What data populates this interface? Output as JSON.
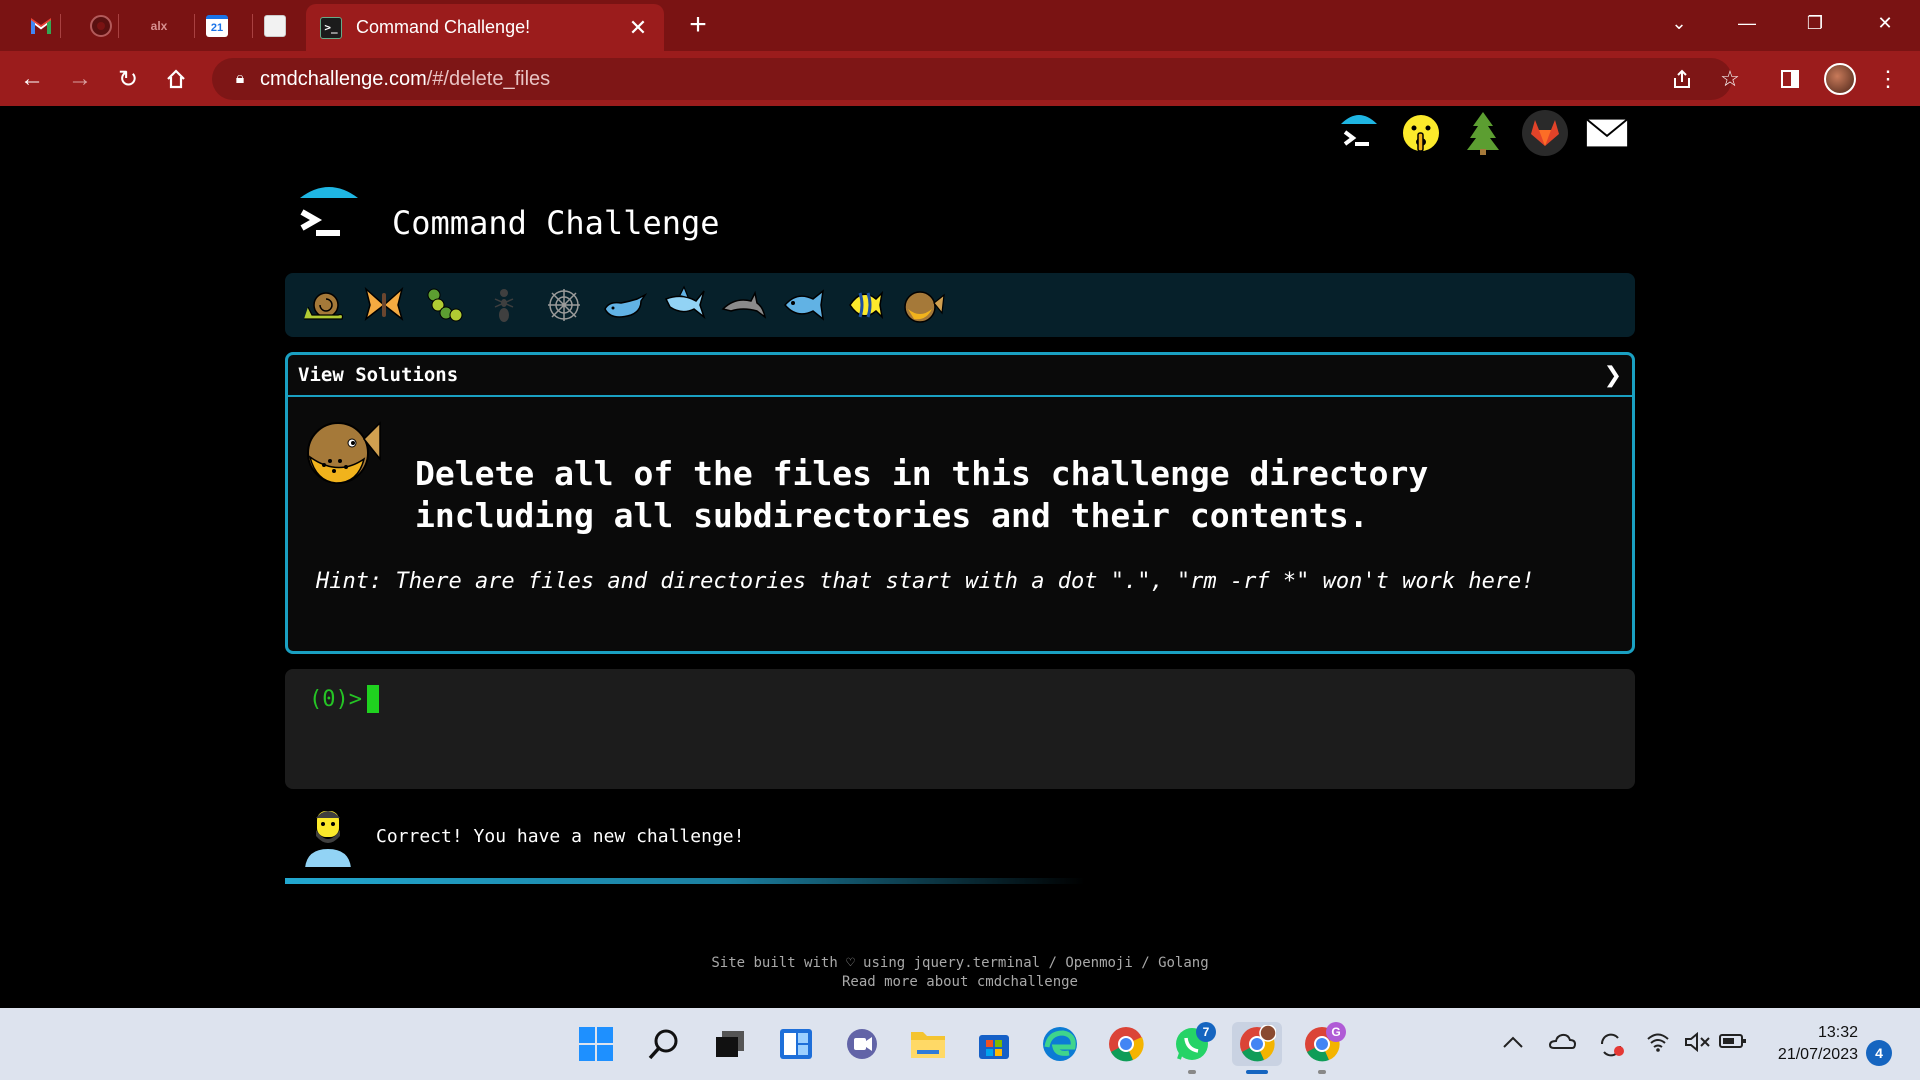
{
  "browser": {
    "pinned_tabs": [
      {
        "icon": "gmail-icon",
        "glyph": "M",
        "color": "#ea4335"
      },
      {
        "icon": "github-icon",
        "glyph": "",
        "color": "#444"
      },
      {
        "icon": "alx-icon",
        "glyph": "alx",
        "color": "#7a1313"
      },
      {
        "icon": "calendar-icon",
        "glyph": "21",
        "color": "#1a73e8"
      },
      {
        "icon": "page-icon",
        "glyph": "",
        "color": "#eee"
      }
    ],
    "active_tab": {
      "title": "Command Challenge!",
      "favicon_glyph": ">_",
      "close": "✕"
    },
    "new_tab": "+",
    "url": {
      "host": "cmdchallenge.com",
      "path": "/#/delete_files"
    },
    "window_controls": {
      "dropdown": "⌄",
      "minimize": "—",
      "restore": "❐",
      "close": "✕"
    },
    "theme_color": "#9b1c1c"
  },
  "page": {
    "site_title": "Command Challenge",
    "top_icons": [
      "terminal-umbrella-icon",
      "shushing-face-icon",
      "tree-icon",
      "gitlab-icon",
      "envelope-icon"
    ],
    "badges": [
      "snail-icon",
      "butterfly-icon",
      "caterpillar-icon",
      "ant-icon",
      "spider-web-icon",
      "whale-icon",
      "shark-icon",
      "dolphin-icon",
      "fish-icon",
      "tropical-fish-icon",
      "blowfish-icon"
    ],
    "solutions_label": "View Solutions",
    "chevron": "❯",
    "task": "Delete all of the files in this challenge directory including all subdirectories and their contents.",
    "hint": "Hint: There are files and directories that start with a dot \".\", \"rm -rf *\" won't work here!",
    "prompt": "(0)>",
    "feedback": "Correct! You have a new challenge!",
    "footer_line1": "Site built with ♡ using jquery.terminal / Openmoji / Golang",
    "footer_line2": "Read more about cmdchallenge",
    "accent_color": "#1aa0c2"
  },
  "taskbar": {
    "apps": [
      "start-icon",
      "search-icon",
      "task-view-icon",
      "widgets-icon",
      "teams-chat-icon",
      "file-explorer-icon",
      "store-icon",
      "edge-icon",
      "chrome-icon",
      "whatsapp-icon",
      "chrome-profile-icon",
      "chrome-g-icon"
    ],
    "whatsapp_badge": "7",
    "chrome_g_badge": "G",
    "time": "13:32",
    "date": "21/07/2023",
    "notifications": "4"
  }
}
